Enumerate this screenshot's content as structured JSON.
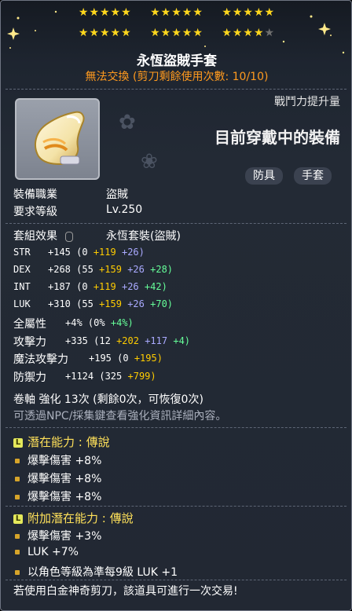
{
  "stars": {
    "row1": [
      "★★★★★",
      "★★★★★",
      "★★★★★"
    ],
    "row2_filled": [
      "★★★★★",
      "★★★★★",
      "★★★★"
    ],
    "row2_dim": "★"
  },
  "item": {
    "name": "永恆盜賊手套",
    "trade_note": "無法交換 (剪刀剩餘使用次數: 10/10)",
    "combat_label": "戰鬥力提升量",
    "equipped_label": "目前穿戴中的裝備",
    "tags": [
      "防具",
      "手套"
    ],
    "icon": "glove-icon"
  },
  "requirements": [
    {
      "label": "裝備職業",
      "value": "盜賊"
    },
    {
      "label": "要求等級",
      "value": "Lv.250"
    }
  ],
  "set_effect": {
    "label": "套組效果",
    "value": "永恆套裝(盜賊)"
  },
  "stats": [
    {
      "name": "STR",
      "total": "+145",
      "base": "(0",
      "parts": [
        {
          "v": "+119",
          "c": "y"
        },
        {
          "v": "+26)",
          "c": "b"
        }
      ]
    },
    {
      "name": "DEX",
      "total": "+268",
      "base": "(55",
      "parts": [
        {
          "v": "+159",
          "c": "y"
        },
        {
          "v": "+26",
          "c": "b"
        },
        {
          "v": "+28)",
          "c": "g"
        }
      ]
    },
    {
      "name": "INT",
      "total": "+187",
      "base": "(0",
      "parts": [
        {
          "v": "+119",
          "c": "y"
        },
        {
          "v": "+26",
          "c": "b"
        },
        {
          "v": "+42)",
          "c": "g"
        }
      ]
    },
    {
      "name": "LUK",
      "total": "+310",
      "base": "(55",
      "parts": [
        {
          "v": "+159",
          "c": "y"
        },
        {
          "v": "+26",
          "c": "b"
        },
        {
          "v": "+70)",
          "c": "g"
        }
      ]
    },
    {
      "name": "全屬性",
      "total": "+4%",
      "base": "(0%",
      "parts": [
        {
          "v": "+4%)",
          "c": "g"
        }
      ]
    },
    {
      "name": "攻擊力",
      "total": "+335",
      "base": "(12",
      "parts": [
        {
          "v": "+202",
          "c": "y"
        },
        {
          "v": "+117",
          "c": "b"
        },
        {
          "v": "+4)",
          "c": "g"
        }
      ]
    },
    {
      "name": "魔法攻擊力",
      "total": "+195",
      "base": "(0",
      "parts": [
        {
          "v": "+195)",
          "c": "y"
        }
      ]
    },
    {
      "name": "防禦力",
      "total": "+1124",
      "base": "(325",
      "parts": [
        {
          "v": "+799)",
          "c": "y"
        }
      ]
    }
  ],
  "scroll": "卷軸 強化 13次 (剩餘0次，可恢復0次)",
  "hint": "可透過NPC/採集鍵查看強化資訊詳細內容。",
  "potential": {
    "title": "潛在能力 : 傳說",
    "lines": [
      "爆擊傷害 +8%",
      "爆擊傷害 +8%",
      "爆擊傷害 +8%"
    ]
  },
  "additional": {
    "title": "附加潛在能力 : 傳說",
    "lines": [
      "爆擊傷害 +3%",
      "LUK +7%",
      "以角色等級為準每9級 LUK +1"
    ]
  },
  "footer": "若使用白金神奇剪刀，該道具可進行一次交易!",
  "colors": {
    "star": "#ffd71d",
    "trade": "#ff9a1e",
    "yellow": "#ffcc00",
    "blue": "#aaaaff",
    "green": "#66ff99",
    "potential": "#ffe15a"
  }
}
